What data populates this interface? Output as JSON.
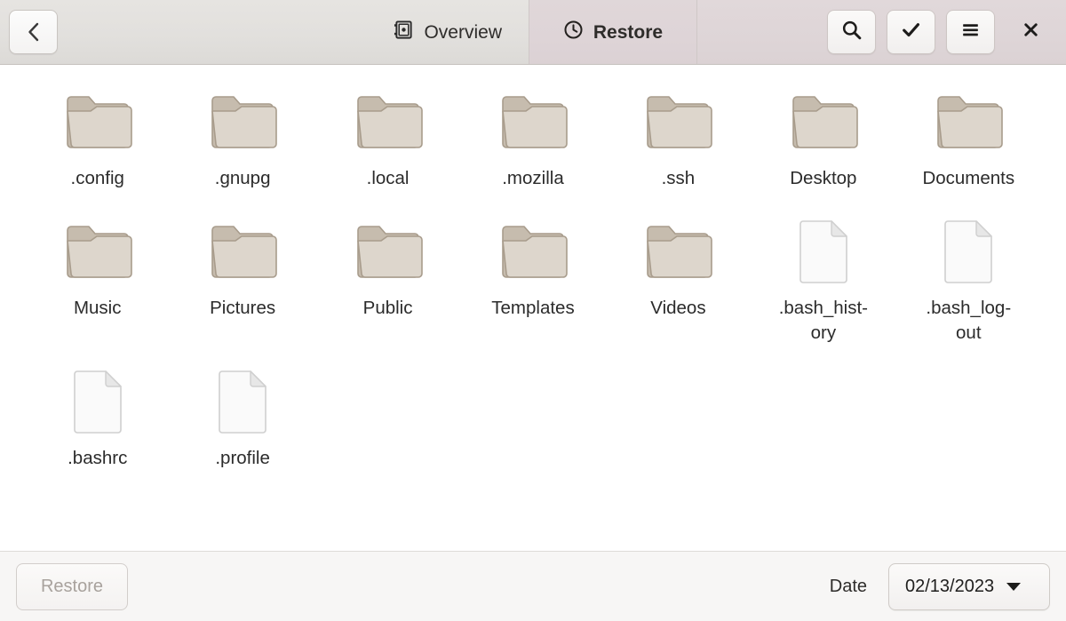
{
  "header": {
    "back_icon": "chevron-left-icon",
    "tabs": [
      {
        "id": "overview",
        "label": "Overview",
        "icon": "safe-vault-icon",
        "active": false
      },
      {
        "id": "restore",
        "label": "Restore",
        "icon": "clock-icon",
        "active": true
      }
    ],
    "buttons": [
      {
        "id": "search",
        "icon": "search-icon"
      },
      {
        "id": "select",
        "icon": "check-icon"
      },
      {
        "id": "menu",
        "icon": "hamburger-menu-icon"
      },
      {
        "id": "close",
        "icon": "close-icon"
      }
    ]
  },
  "files": [
    {
      "name": ".config",
      "type": "folder"
    },
    {
      "name": ".gnupg",
      "type": "folder"
    },
    {
      "name": ".local",
      "type": "folder"
    },
    {
      "name": ".mozilla",
      "type": "folder"
    },
    {
      "name": ".ssh",
      "type": "folder"
    },
    {
      "name": "Desktop",
      "type": "folder"
    },
    {
      "name": "Documents",
      "type": "folder"
    },
    {
      "name": "Music",
      "type": "folder"
    },
    {
      "name": "Pictures",
      "type": "folder"
    },
    {
      "name": "Public",
      "type": "folder"
    },
    {
      "name": "Templates",
      "type": "folder"
    },
    {
      "name": "Videos",
      "type": "folder"
    },
    {
      "name": ".bash_hist-\nory",
      "type": "file"
    },
    {
      "name": ".bash_log-\nout",
      "type": "file"
    },
    {
      "name": ".bashrc",
      "type": "file"
    },
    {
      "name": ".profile",
      "type": "file"
    }
  ],
  "actionbar": {
    "restore_label": "Restore",
    "restore_enabled": false,
    "date_label": "Date",
    "date_value": "02/13/2023",
    "dropdown_icon": "caret-down-icon"
  },
  "colors": {
    "header_bg": "#e2e0dd",
    "tab_active_bg": "#ded4d7",
    "content_bg": "#ffffff",
    "actionbar_bg": "#f7f6f5",
    "folder_body": "#ddd6cc",
    "folder_tab": "#c6bcae",
    "folder_border": "#a89c8c",
    "file_body": "#fafafa",
    "file_border": "#cfcfcf",
    "text": "#2b2b2b",
    "text_disabled": "#a8a29d"
  }
}
